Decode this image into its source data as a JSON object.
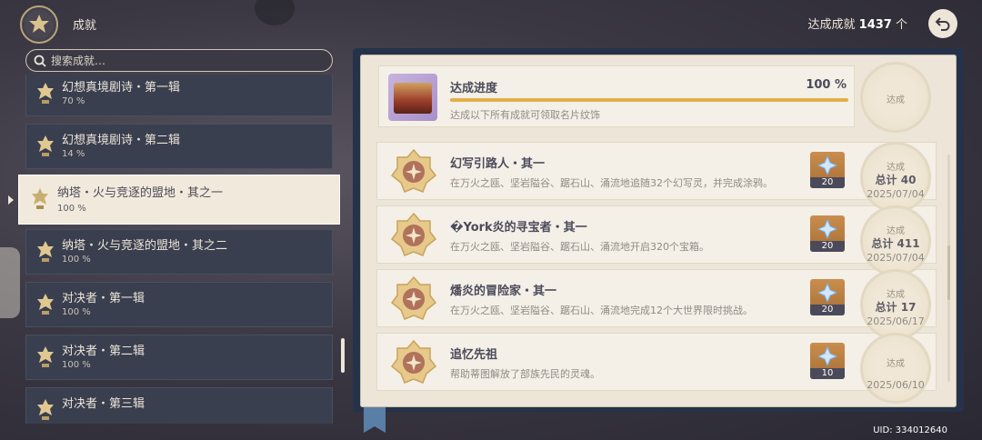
{
  "header": {
    "title": "成就",
    "count_label": "达成成就",
    "count_value": "1437",
    "count_unit": "个"
  },
  "search": {
    "placeholder": "搜索成就…"
  },
  "categories": [
    {
      "name": "幻想真境剧诗・第一辑",
      "percent": "70 %"
    },
    {
      "name": "幻想真境剧诗・第二辑",
      "percent": "14 %"
    },
    {
      "name": "纳塔・火与竞逐的盟地・其之一",
      "percent": "100 %",
      "selected": true
    },
    {
      "name": "纳塔・火与竞逐的盟地・其之二",
      "percent": "100 %"
    },
    {
      "name": "对决者・第一辑",
      "percent": "100 %"
    },
    {
      "name": "对决者・第二辑",
      "percent": "100 %"
    },
    {
      "name": "对决者・第三辑",
      "percent": ""
    }
  ],
  "progress": {
    "label": "达成进度",
    "percent_text": "100 %",
    "value": 1.0,
    "description": "达成以下所有成就可领取名片纹饰",
    "stamp_text": "达成"
  },
  "achievements": [
    {
      "name": "幻写引路人・其一",
      "description": "在万火之瓯、坚岩隘谷、踞石山、涌流地追随32个幻写灵，并完成涂鸦。",
      "reward_qty": "20",
      "stamp_text": "达成",
      "total": "总计 40",
      "date": "2025/07/04"
    },
    {
      "name": "�York炎的寻宝者・其一",
      "description": "在万火之瓯、坚岩隘谷、踞石山、涌流地开启320个宝箱。",
      "reward_qty": "20",
      "stamp_text": "达成",
      "total": "总计 411",
      "date": "2025/07/04"
    },
    {
      "name": "燔炎的冒险家・其一",
      "description": "在万火之瓯、坚岩隘谷、踞石山、涌流地完成12个大世界限时挑战。",
      "reward_qty": "20",
      "stamp_text": "达成",
      "total": "总计 17",
      "date": "2025/06/17"
    },
    {
      "name": "追忆先祖",
      "description": "帮助蒂图解放了部族先民的灵魂。",
      "reward_qty": "10",
      "stamp_text": "达成",
      "total": "",
      "date": "2025/06/10"
    }
  ],
  "footer": {
    "uid": "UID: 334012640"
  },
  "icons": {
    "emblem": "achievement-emblem-icon",
    "back": "back-arrow-icon",
    "search": "search-icon",
    "category": "trophy-icon",
    "medal": "achievement-medal-icon",
    "reward": "primogem-icon"
  },
  "colors": {
    "accent": "#e2b04a",
    "panel": "#ece5d8",
    "sidebar_item": "#3a3f4f"
  }
}
